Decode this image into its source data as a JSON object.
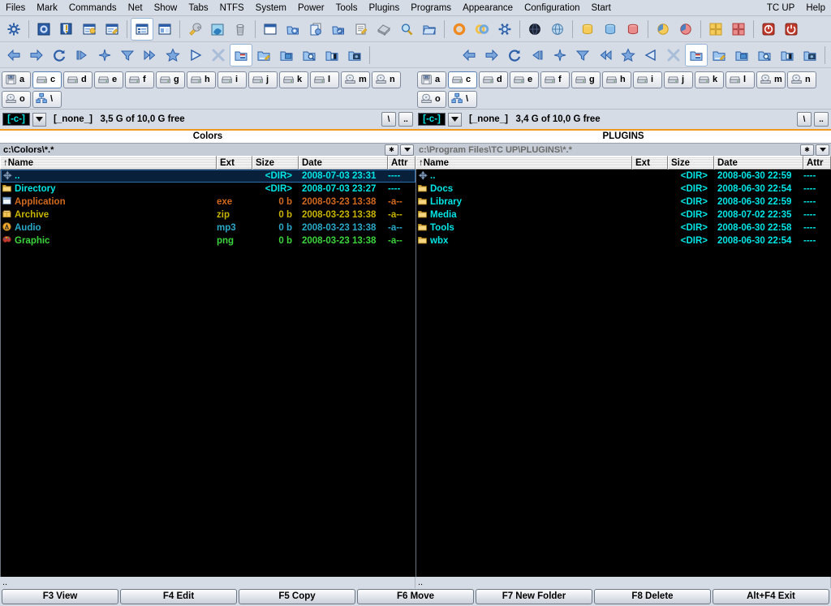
{
  "menu": {
    "left_items": [
      "Files",
      "Mark",
      "Commands",
      "Net",
      "Show",
      "Tabs",
      "NTFS",
      "System",
      "Power",
      "Tools",
      "Plugins",
      "Programs",
      "Appearance",
      "Configuration",
      "Start"
    ],
    "right_items": [
      "TC UP",
      "Help"
    ]
  },
  "toolbar": {
    "buttons": [
      {
        "name": "gear-icon",
        "sep_after": true
      },
      {
        "name": "config-dialog-icon"
      },
      {
        "name": "warning-panel-icon"
      },
      {
        "name": "window-star-icon"
      },
      {
        "name": "window-edit-icon",
        "sep_after": true
      },
      {
        "name": "list-view-icon",
        "pressed": true
      },
      {
        "name": "split-view-icon",
        "sep_after": true
      },
      {
        "name": "wrench-icon"
      },
      {
        "name": "blue-swirl-icon"
      },
      {
        "name": "trash-icon",
        "sep_after": true
      },
      {
        "name": "window-blank-icon"
      },
      {
        "name": "sync-dirs-icon"
      },
      {
        "name": "copy-file-icon"
      },
      {
        "name": "refresh-file-icon"
      },
      {
        "name": "notepad-edit-icon"
      },
      {
        "name": "disk-pack-icon"
      },
      {
        "name": "search-icon"
      },
      {
        "name": "open-folder-icon",
        "sep_after": true
      },
      {
        "name": "orange-ring-icon"
      },
      {
        "name": "gold-rings-icon"
      },
      {
        "name": "blue-cog-icon",
        "sep_after": true
      },
      {
        "name": "dark-globe-icon"
      },
      {
        "name": "light-globe-icon",
        "sep_after": true
      },
      {
        "name": "yellow-db-icon"
      },
      {
        "name": "blue-db-icon"
      },
      {
        "name": "red-db-icon",
        "sep_after": true
      },
      {
        "name": "yellow-pie-icon"
      },
      {
        "name": "red-pie-icon",
        "sep_after": true
      },
      {
        "name": "yellow-grid-icon"
      },
      {
        "name": "red-grid-icon",
        "sep_after": true
      },
      {
        "name": "power-off-icon"
      },
      {
        "name": "shutdown-icon"
      }
    ]
  },
  "navbar": {
    "left_buttons": [
      {
        "name": "back-arrow-icon"
      },
      {
        "name": "forward-arrow-icon"
      },
      {
        "name": "refresh-icon"
      },
      {
        "name": "step-right-icon"
      },
      {
        "name": "sparkle-icon"
      },
      {
        "name": "filter-icon"
      },
      {
        "name": "fast-forward-icon"
      },
      {
        "name": "favorites-star-icon"
      },
      {
        "name": "play-icon"
      },
      {
        "name": "close-x-icon"
      },
      {
        "name": "tab-flag-icon",
        "pressed": true
      },
      {
        "name": "tab-edit-icon"
      },
      {
        "name": "tab-window-icon"
      },
      {
        "name": "tab-search-icon"
      },
      {
        "name": "tab-split-icon"
      },
      {
        "name": "tab-photo-icon"
      }
    ],
    "right_buttons": [
      {
        "name": "back-arrow-icon"
      },
      {
        "name": "forward-arrow-icon"
      },
      {
        "name": "refresh-icon"
      },
      {
        "name": "step-left-icon"
      },
      {
        "name": "sparkle-icon"
      },
      {
        "name": "filter-icon"
      },
      {
        "name": "fast-backward-icon"
      },
      {
        "name": "favorites-star-icon"
      },
      {
        "name": "play-left-icon"
      },
      {
        "name": "close-x-icon"
      },
      {
        "name": "tab-flag-icon",
        "pressed": true
      },
      {
        "name": "tab-edit-icon"
      },
      {
        "name": "tab-window-icon"
      },
      {
        "name": "tab-search-icon"
      },
      {
        "name": "tab-split-icon"
      },
      {
        "name": "tab-photo-icon"
      }
    ]
  },
  "drive_buttons": {
    "left_row1": [
      "a",
      "c",
      "d",
      "e",
      "f",
      "g",
      "h",
      "i",
      "j",
      "k",
      "l",
      "m",
      "n"
    ],
    "left_row2": [
      "o",
      "\\"
    ],
    "right_row1": [
      "a",
      "c",
      "d",
      "e",
      "f",
      "g",
      "h",
      "i",
      "j",
      "k",
      "l",
      "m",
      "n"
    ],
    "right_row2": [
      "o",
      "\\"
    ],
    "active": "c"
  },
  "left_panel": {
    "drive_label": "[-c-]",
    "volume": "[_none_]",
    "free_space": "3,5 G of 10,0 G free",
    "root_btn": "\\",
    "up_btn": "..",
    "tab_title": "Colors",
    "path": "c:\\Colors\\*.*",
    "columns": [
      "↑Name",
      "Ext",
      "Size",
      "Date",
      "Attr"
    ],
    "footer": "..",
    "files": [
      {
        "icon": "up-dir-icon",
        "name": "..",
        "ext": "",
        "size": "<DIR>",
        "date": "2008-07-03 23:31",
        "attr": "----",
        "color": "#00e5e5",
        "cursor": true
      },
      {
        "icon": "folder-icon",
        "name": "Directory",
        "ext": "",
        "size": "<DIR>",
        "date": "2008-07-03 23:27",
        "attr": "----",
        "color": "#00e5e5"
      },
      {
        "icon": "application-icon",
        "name": "Application",
        "ext": "exe",
        "size": "0 b",
        "date": "2008-03-23 13:38",
        "attr": "-a--",
        "color": "#d2691e"
      },
      {
        "icon": "archive-icon",
        "name": "Archive",
        "ext": "zip",
        "size": "0 b",
        "date": "2008-03-23 13:38",
        "attr": "-a--",
        "color": "#c8b400"
      },
      {
        "icon": "audio-icon",
        "name": "Audio",
        "ext": "mp3",
        "size": "0 b",
        "date": "2008-03-23 13:38",
        "attr": "-a--",
        "color": "#2aa8c8"
      },
      {
        "icon": "graphic-icon",
        "name": "Graphic",
        "ext": "png",
        "size": "0 b",
        "date": "2008-03-23 13:38",
        "attr": "-a--",
        "color": "#3cd43c"
      }
    ]
  },
  "right_panel": {
    "drive_label": "[-c-]",
    "volume": "[_none_]",
    "free_space": "3,4 G of 10,0 G free",
    "root_btn": "\\",
    "up_btn": "..",
    "tab_title": "PLUGINS",
    "path": "c:\\Program Files\\TC UP\\PLUGINS\\*.*",
    "columns": [
      "↑Name",
      "Ext",
      "Size",
      "Date",
      "Attr"
    ],
    "footer": "..",
    "files": [
      {
        "icon": "up-dir-icon",
        "name": "..",
        "ext": "",
        "size": "<DIR>",
        "date": "2008-06-30 22:59",
        "attr": "----",
        "color": "#00e5e5"
      },
      {
        "icon": "folder-icon",
        "name": "Docs",
        "ext": "",
        "size": "<DIR>",
        "date": "2008-06-30 22:54",
        "attr": "----",
        "color": "#00e5e5"
      },
      {
        "icon": "folder-icon",
        "name": "Library",
        "ext": "",
        "size": "<DIR>",
        "date": "2008-06-30 22:59",
        "attr": "----",
        "color": "#00e5e5"
      },
      {
        "icon": "folder-icon",
        "name": "Media",
        "ext": "",
        "size": "<DIR>",
        "date": "2008-07-02 22:35",
        "attr": "----",
        "color": "#00e5e5"
      },
      {
        "icon": "folder-icon",
        "name": "Tools",
        "ext": "",
        "size": "<DIR>",
        "date": "2008-06-30 22:58",
        "attr": "----",
        "color": "#00e5e5"
      },
      {
        "icon": "folder-icon",
        "name": "wbx",
        "ext": "",
        "size": "<DIR>",
        "date": "2008-06-30 22:54",
        "attr": "----",
        "color": "#00e5e5"
      }
    ]
  },
  "function_bar": {
    "buttons": [
      "F3 View",
      "F4 Edit",
      "F5 Copy",
      "F6 Move",
      "F7 New Folder",
      "F8 Delete",
      "Alt+F4 Exit"
    ]
  },
  "colors": {
    "accent_orange": "#ef9a1e",
    "panel_bg": "#000000",
    "dir_cyan": "#00e5e5",
    "chrome": "#d6dce6"
  }
}
